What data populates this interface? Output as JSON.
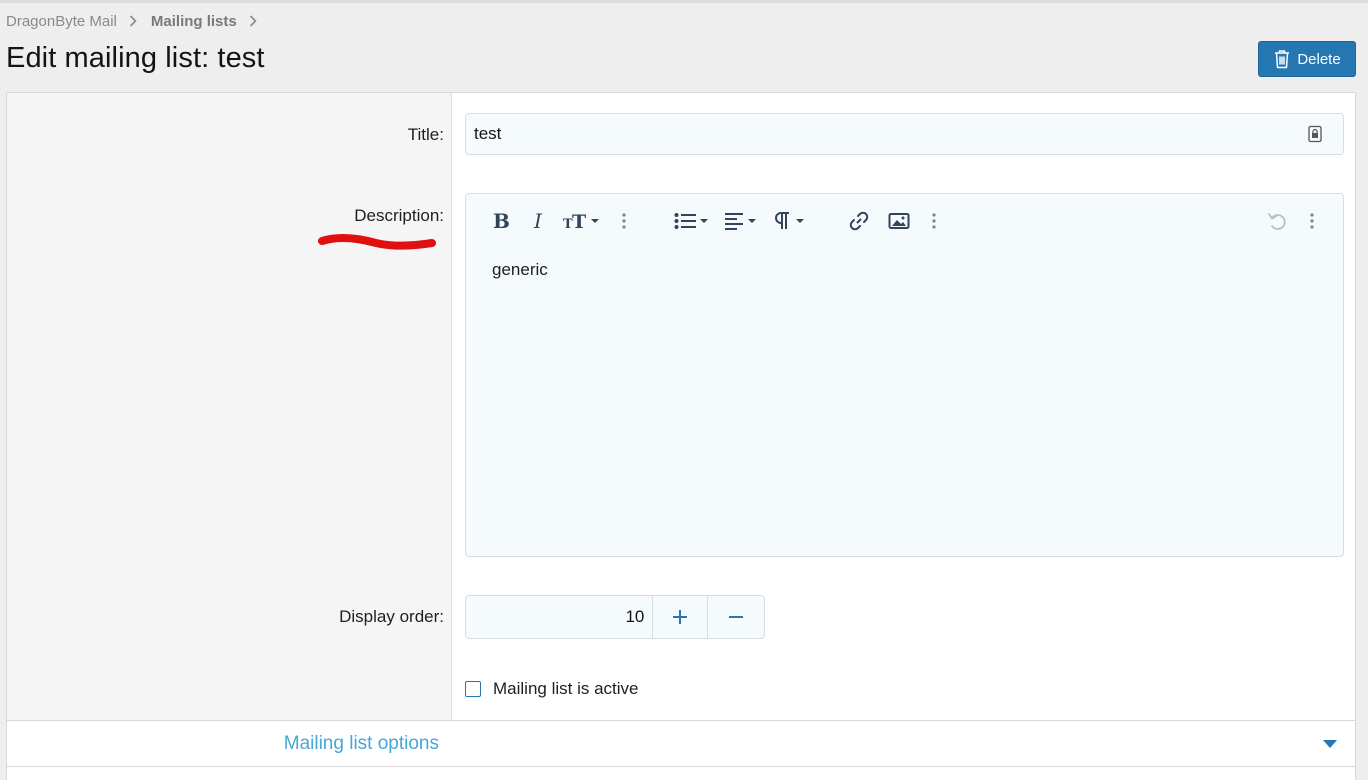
{
  "breadcrumb": [
    {
      "label": "DragonByte Mail",
      "bold": false
    },
    {
      "label": "Mailing lists",
      "bold": true
    }
  ],
  "page_title": "Edit mailing list: test",
  "header": {
    "delete_label": "Delete"
  },
  "form": {
    "title_label": "Title:",
    "title_value": "test",
    "description_label": "Description:",
    "description_value": "generic",
    "display_order_label": "Display order:",
    "display_order_value": "10",
    "active_label": "Mailing list is active",
    "active_checked": false
  },
  "editor_toolbar": [
    "bold-icon",
    "italic-icon",
    "text-size-icon",
    "more-icon",
    "list-icon",
    "align-icon",
    "paragraph-icon",
    "link-icon",
    "image-icon",
    "more-icon",
    "undo-icon",
    "more-icon"
  ],
  "options_section": {
    "label": "Mailing list options"
  },
  "colors": {
    "accent": "#2577b1",
    "link": "#47a7d6",
    "annotation": "#e01010"
  }
}
